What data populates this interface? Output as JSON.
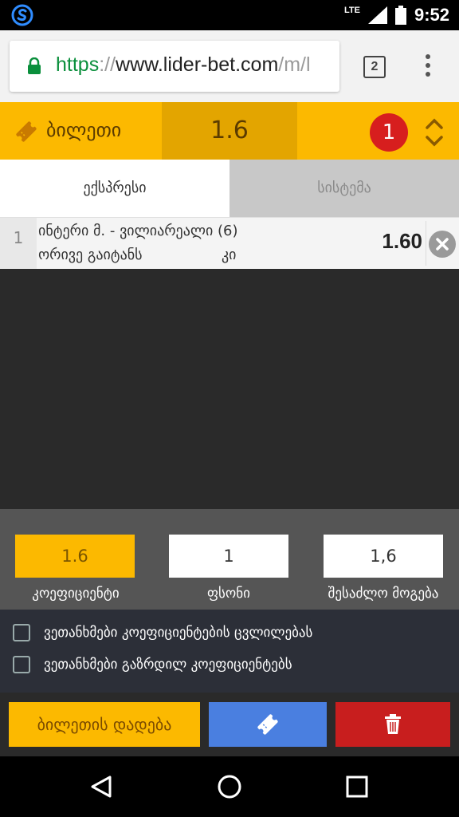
{
  "status_bar": {
    "app_icon": "s-logo-icon",
    "network": "LTE",
    "time": "9:52"
  },
  "browser": {
    "url_scheme": "https",
    "url_sep": "://",
    "url_host": "www.lider-bet.com",
    "url_path": "/m/l",
    "tab_count": "2"
  },
  "ticket": {
    "label": "ბილეთი",
    "odds": "1.6",
    "bet_count": "1",
    "accent": "#fcb900"
  },
  "tabs": {
    "express": "ექსპრესი",
    "system": "სისტემა"
  },
  "bets": [
    {
      "index": "1",
      "match": "ინტერი მ. - ვილიარეალი (6)",
      "market": "ორივე გაიტანს",
      "pick": "კი",
      "odd": "1.60"
    }
  ],
  "summary": {
    "coefficient_value": "1.6",
    "stake_value": "1",
    "possible_win_value": "1,6",
    "coefficient_label": "კოეფიციენტი",
    "stake_label": "ფსონი",
    "possible_win_label": "შესაძლო მოგება"
  },
  "options": {
    "accept_change": "ვეთანხმები კოეფიციენტების ცვლილებას",
    "accept_increase": "ვეთანხმები გაზრდილ კოეფიციენტებს"
  },
  "actions": {
    "place_bet": "ბილეთის დადება",
    "save_icon": "ticket-icon",
    "delete_icon": "trash-icon"
  },
  "colors": {
    "gold": "#fcb900",
    "blue": "#4a7fe0",
    "red": "#c81e1e"
  }
}
